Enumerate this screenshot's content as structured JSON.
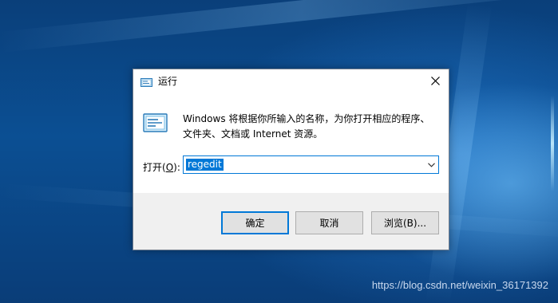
{
  "dialog": {
    "title": "运行",
    "description_line1": "Windows 将根据你所输入的名称，为你打开相应的程序、",
    "description_line2": "文件夹、文档或 Internet 资源。",
    "open_label_prefix": "打开(",
    "open_label_key": "O",
    "open_label_suffix": "):",
    "input_value": "regedit",
    "buttons": {
      "ok": "确定",
      "cancel": "取消",
      "browse": "浏览(B)..."
    }
  },
  "watermark": "https://blog.csdn.net/weixin_36171392",
  "icons": {
    "title": "run-icon",
    "big": "run-icon",
    "close": "close-icon",
    "dropdown": "chevron-down-icon"
  },
  "colors": {
    "accent": "#0078d7",
    "button_bar": "#f0f0f0",
    "button": "#e1e1e1"
  }
}
